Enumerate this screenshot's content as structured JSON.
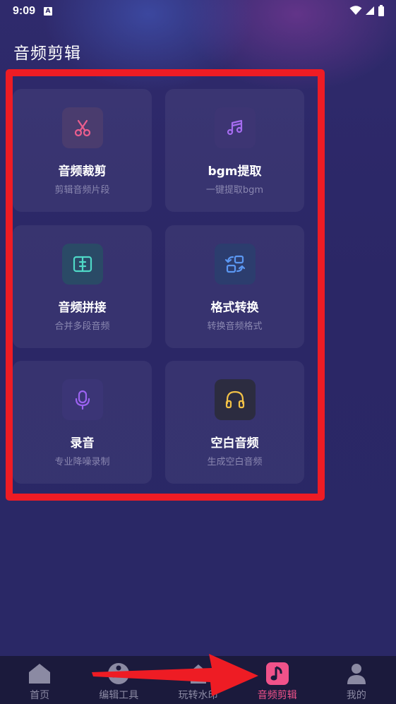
{
  "status_bar": {
    "time": "9:09",
    "notification_glyph": "A"
  },
  "page": {
    "title": "音频剪辑"
  },
  "tools": [
    {
      "title": "音频裁剪",
      "subtitle": "剪辑音频片段",
      "icon": "scissors-icon",
      "color": "#ec5e8e",
      "bg": "#4a3c6e"
    },
    {
      "title": "bgm提取",
      "subtitle": "一键提取bgm",
      "icon": "music-note-icon",
      "color": "#a66cf0",
      "bg": "#3d3573"
    },
    {
      "title": "音频拼接",
      "subtitle": "合并多段音频",
      "icon": "merge-icon",
      "color": "#4fd9c7",
      "bg": "#2a4a66"
    },
    {
      "title": "格式转换",
      "subtitle": "转换音频格式",
      "icon": "convert-icon",
      "color": "#5b97f2",
      "bg": "#2c3d6e"
    },
    {
      "title": "录音",
      "subtitle": "专业降噪录制",
      "icon": "microphone-icon",
      "color": "#9b62f0",
      "bg": "#3b3576"
    },
    {
      "title": "空白音频",
      "subtitle": "生成空白音频",
      "icon": "headphones-icon",
      "color": "#f3c247",
      "bg": "#2c2c40"
    }
  ],
  "nav": {
    "items": [
      {
        "label": "首页",
        "icon": "home-icon"
      },
      {
        "label": "编辑工具",
        "icon": "film-reel-icon"
      },
      {
        "label": "玩转水印",
        "icon": "watermark-icon"
      },
      {
        "label": "音频剪辑",
        "icon": "music-note-icon",
        "active": true
      },
      {
        "label": "我的",
        "icon": "user-icon"
      }
    ],
    "active_color": "#f0528a",
    "inactive_color": "#8b8aa3"
  }
}
